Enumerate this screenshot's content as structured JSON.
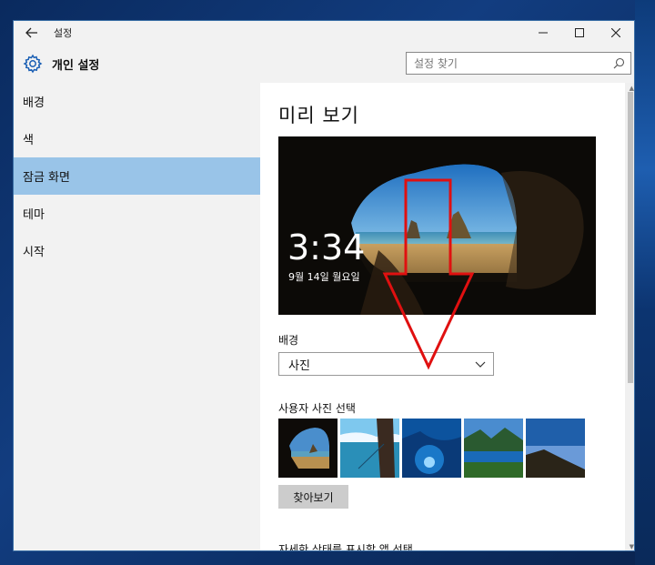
{
  "window": {
    "title": "설정",
    "header_title": "개인 설정"
  },
  "search": {
    "placeholder": "설정 찾기"
  },
  "sidebar": {
    "items": [
      {
        "label": "배경"
      },
      {
        "label": "색"
      },
      {
        "label": "잠금 화면"
      },
      {
        "label": "테마"
      },
      {
        "label": "시작"
      }
    ],
    "active_index": 2
  },
  "main": {
    "page_title": "미리 보기",
    "preview": {
      "time": "3:34",
      "date": "9월 14일 월요일"
    },
    "background_label": "배경",
    "background_value": "사진",
    "choose_photo_label": "사용자 사진 선택",
    "browse_label": "찾아보기",
    "clipped_label": "자세한 상태를 표시할 앱 선택"
  },
  "colors": {
    "accent_active": "#99c4e8",
    "annotation_arrow": "#e01010",
    "sidebar_bg": "#f2f2f2"
  },
  "icons": {
    "back": "back-arrow-icon",
    "gear": "gear-icon",
    "search": "search-icon",
    "minimize": "minimize-icon",
    "maximize": "maximize-icon",
    "close": "close-icon",
    "chevron": "chevron-down-icon"
  }
}
